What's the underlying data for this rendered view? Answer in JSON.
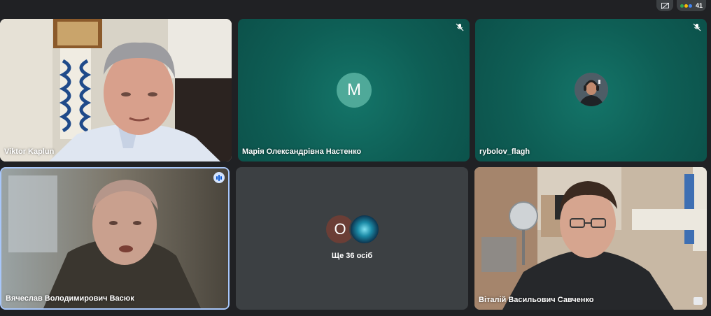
{
  "topbar": {
    "participant_count": "41"
  },
  "tiles": [
    {
      "name": "Viktor Kaplun",
      "type": "video"
    },
    {
      "name": "Марія Олександрівна Настенко",
      "type": "avatar",
      "avatar_letter": "M",
      "muted": true
    },
    {
      "name": "rybolov_flagh",
      "type": "avatar-photo",
      "muted": true
    },
    {
      "name": "Вячеслав Володимирович Васюк",
      "type": "video",
      "speaking": true
    },
    {
      "name": "",
      "type": "more",
      "avatar_letter": "O",
      "more_label": "Ще 36 осіб"
    },
    {
      "name": "Віталій Васильович Савченко",
      "type": "video"
    }
  ],
  "colors": {
    "accent_active": "#a8c7fa",
    "tile_teal": "#0e5e55",
    "avatar_m": "#4fa999",
    "tile_grey": "#3c4043"
  },
  "icons": [
    "presentation-hidden-icon",
    "people-icon",
    "mic-off-icon",
    "speaking-indicator-icon",
    "picture-in-picture-icon"
  ]
}
